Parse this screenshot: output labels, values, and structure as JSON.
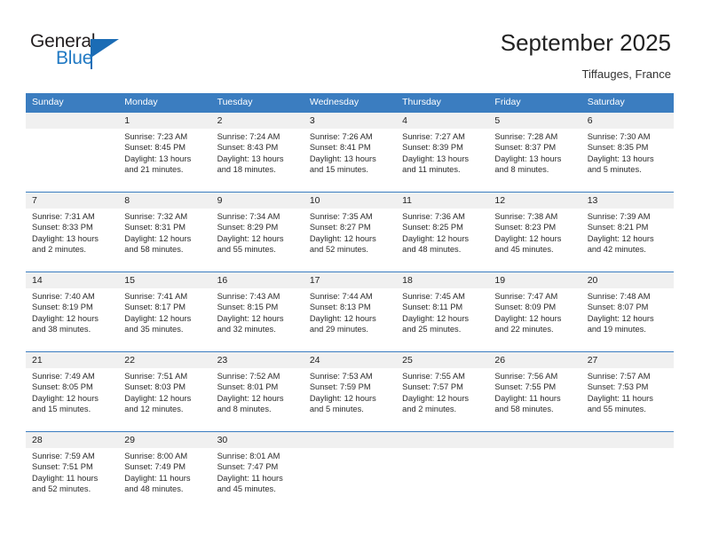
{
  "brand": {
    "name_part1": "General",
    "name_part2": "Blue",
    "accent_color": "#1b6cb5"
  },
  "header": {
    "title": "September 2025",
    "subtitle": "Tiffauges, France"
  },
  "theme": {
    "header_row_bg": "#3b7dc0",
    "daynum_bg": "#f0f0f0",
    "grid_line": "#3b7dc0"
  },
  "labels": {
    "sunrise_prefix": "Sunrise:",
    "sunset_prefix": "Sunset:",
    "daylight_prefix": "Daylight:"
  },
  "weekday_headers": [
    "Sunday",
    "Monday",
    "Tuesday",
    "Wednesday",
    "Thursday",
    "Friday",
    "Saturday"
  ],
  "weeks": [
    [
      {
        "day": "",
        "blank": true
      },
      {
        "day": "1",
        "sunrise": "Sunrise: 7:23 AM",
        "sunset": "Sunset: 8:45 PM",
        "daylight_line1": "Daylight: 13 hours",
        "daylight_line2": "and 21 minutes."
      },
      {
        "day": "2",
        "sunrise": "Sunrise: 7:24 AM",
        "sunset": "Sunset: 8:43 PM",
        "daylight_line1": "Daylight: 13 hours",
        "daylight_line2": "and 18 minutes."
      },
      {
        "day": "3",
        "sunrise": "Sunrise: 7:26 AM",
        "sunset": "Sunset: 8:41 PM",
        "daylight_line1": "Daylight: 13 hours",
        "daylight_line2": "and 15 minutes."
      },
      {
        "day": "4",
        "sunrise": "Sunrise: 7:27 AM",
        "sunset": "Sunset: 8:39 PM",
        "daylight_line1": "Daylight: 13 hours",
        "daylight_line2": "and 11 minutes."
      },
      {
        "day": "5",
        "sunrise": "Sunrise: 7:28 AM",
        "sunset": "Sunset: 8:37 PM",
        "daylight_line1": "Daylight: 13 hours",
        "daylight_line2": "and 8 minutes."
      },
      {
        "day": "6",
        "sunrise": "Sunrise: 7:30 AM",
        "sunset": "Sunset: 8:35 PM",
        "daylight_line1": "Daylight: 13 hours",
        "daylight_line2": "and 5 minutes."
      }
    ],
    [
      {
        "day": "7",
        "sunrise": "Sunrise: 7:31 AM",
        "sunset": "Sunset: 8:33 PM",
        "daylight_line1": "Daylight: 13 hours",
        "daylight_line2": "and 2 minutes."
      },
      {
        "day": "8",
        "sunrise": "Sunrise: 7:32 AM",
        "sunset": "Sunset: 8:31 PM",
        "daylight_line1": "Daylight: 12 hours",
        "daylight_line2": "and 58 minutes."
      },
      {
        "day": "9",
        "sunrise": "Sunrise: 7:34 AM",
        "sunset": "Sunset: 8:29 PM",
        "daylight_line1": "Daylight: 12 hours",
        "daylight_line2": "and 55 minutes."
      },
      {
        "day": "10",
        "sunrise": "Sunrise: 7:35 AM",
        "sunset": "Sunset: 8:27 PM",
        "daylight_line1": "Daylight: 12 hours",
        "daylight_line2": "and 52 minutes."
      },
      {
        "day": "11",
        "sunrise": "Sunrise: 7:36 AM",
        "sunset": "Sunset: 8:25 PM",
        "daylight_line1": "Daylight: 12 hours",
        "daylight_line2": "and 48 minutes."
      },
      {
        "day": "12",
        "sunrise": "Sunrise: 7:38 AM",
        "sunset": "Sunset: 8:23 PM",
        "daylight_line1": "Daylight: 12 hours",
        "daylight_line2": "and 45 minutes."
      },
      {
        "day": "13",
        "sunrise": "Sunrise: 7:39 AM",
        "sunset": "Sunset: 8:21 PM",
        "daylight_line1": "Daylight: 12 hours",
        "daylight_line2": "and 42 minutes."
      }
    ],
    [
      {
        "day": "14",
        "sunrise": "Sunrise: 7:40 AM",
        "sunset": "Sunset: 8:19 PM",
        "daylight_line1": "Daylight: 12 hours",
        "daylight_line2": "and 38 minutes."
      },
      {
        "day": "15",
        "sunrise": "Sunrise: 7:41 AM",
        "sunset": "Sunset: 8:17 PM",
        "daylight_line1": "Daylight: 12 hours",
        "daylight_line2": "and 35 minutes."
      },
      {
        "day": "16",
        "sunrise": "Sunrise: 7:43 AM",
        "sunset": "Sunset: 8:15 PM",
        "daylight_line1": "Daylight: 12 hours",
        "daylight_line2": "and 32 minutes."
      },
      {
        "day": "17",
        "sunrise": "Sunrise: 7:44 AM",
        "sunset": "Sunset: 8:13 PM",
        "daylight_line1": "Daylight: 12 hours",
        "daylight_line2": "and 29 minutes."
      },
      {
        "day": "18",
        "sunrise": "Sunrise: 7:45 AM",
        "sunset": "Sunset: 8:11 PM",
        "daylight_line1": "Daylight: 12 hours",
        "daylight_line2": "and 25 minutes."
      },
      {
        "day": "19",
        "sunrise": "Sunrise: 7:47 AM",
        "sunset": "Sunset: 8:09 PM",
        "daylight_line1": "Daylight: 12 hours",
        "daylight_line2": "and 22 minutes."
      },
      {
        "day": "20",
        "sunrise": "Sunrise: 7:48 AM",
        "sunset": "Sunset: 8:07 PM",
        "daylight_line1": "Daylight: 12 hours",
        "daylight_line2": "and 19 minutes."
      }
    ],
    [
      {
        "day": "21",
        "sunrise": "Sunrise: 7:49 AM",
        "sunset": "Sunset: 8:05 PM",
        "daylight_line1": "Daylight: 12 hours",
        "daylight_line2": "and 15 minutes."
      },
      {
        "day": "22",
        "sunrise": "Sunrise: 7:51 AM",
        "sunset": "Sunset: 8:03 PM",
        "daylight_line1": "Daylight: 12 hours",
        "daylight_line2": "and 12 minutes."
      },
      {
        "day": "23",
        "sunrise": "Sunrise: 7:52 AM",
        "sunset": "Sunset: 8:01 PM",
        "daylight_line1": "Daylight: 12 hours",
        "daylight_line2": "and 8 minutes."
      },
      {
        "day": "24",
        "sunrise": "Sunrise: 7:53 AM",
        "sunset": "Sunset: 7:59 PM",
        "daylight_line1": "Daylight: 12 hours",
        "daylight_line2": "and 5 minutes."
      },
      {
        "day": "25",
        "sunrise": "Sunrise: 7:55 AM",
        "sunset": "Sunset: 7:57 PM",
        "daylight_line1": "Daylight: 12 hours",
        "daylight_line2": "and 2 minutes."
      },
      {
        "day": "26",
        "sunrise": "Sunrise: 7:56 AM",
        "sunset": "Sunset: 7:55 PM",
        "daylight_line1": "Daylight: 11 hours",
        "daylight_line2": "and 58 minutes."
      },
      {
        "day": "27",
        "sunrise": "Sunrise: 7:57 AM",
        "sunset": "Sunset: 7:53 PM",
        "daylight_line1": "Daylight: 11 hours",
        "daylight_line2": "and 55 minutes."
      }
    ],
    [
      {
        "day": "28",
        "sunrise": "Sunrise: 7:59 AM",
        "sunset": "Sunset: 7:51 PM",
        "daylight_line1": "Daylight: 11 hours",
        "daylight_line2": "and 52 minutes."
      },
      {
        "day": "29",
        "sunrise": "Sunrise: 8:00 AM",
        "sunset": "Sunset: 7:49 PM",
        "daylight_line1": "Daylight: 11 hours",
        "daylight_line2": "and 48 minutes."
      },
      {
        "day": "30",
        "sunrise": "Sunrise: 8:01 AM",
        "sunset": "Sunset: 7:47 PM",
        "daylight_line1": "Daylight: 11 hours",
        "daylight_line2": "and 45 minutes."
      },
      {
        "day": "",
        "blank": true
      },
      {
        "day": "",
        "blank": true
      },
      {
        "day": "",
        "blank": true
      },
      {
        "day": "",
        "blank": true
      }
    ]
  ]
}
